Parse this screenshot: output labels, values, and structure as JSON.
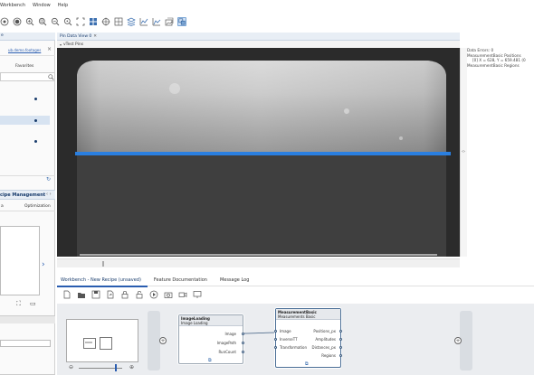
{
  "menu": {
    "items": [
      "Workbench",
      "Window",
      "Help"
    ]
  },
  "toolbar": {
    "icons": [
      "target-icon",
      "record-icon",
      "zoom-in-icon",
      "zoom-fit-icon",
      "zoom-out-icon",
      "zoom-reset-icon",
      "fit-view-icon",
      "grid-icon",
      "crosshair-icon",
      "table-grid-icon",
      "layers-icon",
      "line-chart-icon",
      "area-chart-icon",
      "image-stack-icon",
      "linked-view-icon"
    ]
  },
  "left_panel": {
    "tab_label": "e",
    "link_text": "ub.demo.footages",
    "favorites_label": "Favorites",
    "recipe_mgmt_label": "cipe Management",
    "tabs": [
      "a",
      "Optimization"
    ]
  },
  "view": {
    "tab_title": "Pin Data View 0",
    "sub_title": "vTest Pins"
  },
  "info": {
    "lines": [
      "Data Errors: 0",
      "MeasurementBasic Positions",
      "[0] X = 628, Y = 659.481 (0",
      "MeasurementBasic Regions"
    ]
  },
  "workbench": {
    "tabs": [
      "Workbench - New Recipe (unsaved)",
      "Feature Documentation",
      "Message Log"
    ]
  },
  "nodes": {
    "image_loading": {
      "title": "ImageLoading",
      "subtitle": "Image Loading",
      "outputs": [
        "Image",
        "ImagePath",
        "RunCount"
      ]
    },
    "measurement_basic": {
      "title": "MeasurementBasic",
      "subtitle": "Measurements Basic",
      "inputs": [
        "Image",
        "InverseTT",
        "Transformation"
      ],
      "outputs": [
        "Positions_px",
        "Amplitudes",
        "Distances_px",
        "Regions"
      ]
    }
  },
  "colors": {
    "detected_line": "#2a7fe0",
    "accent": "#1a3d6d"
  }
}
